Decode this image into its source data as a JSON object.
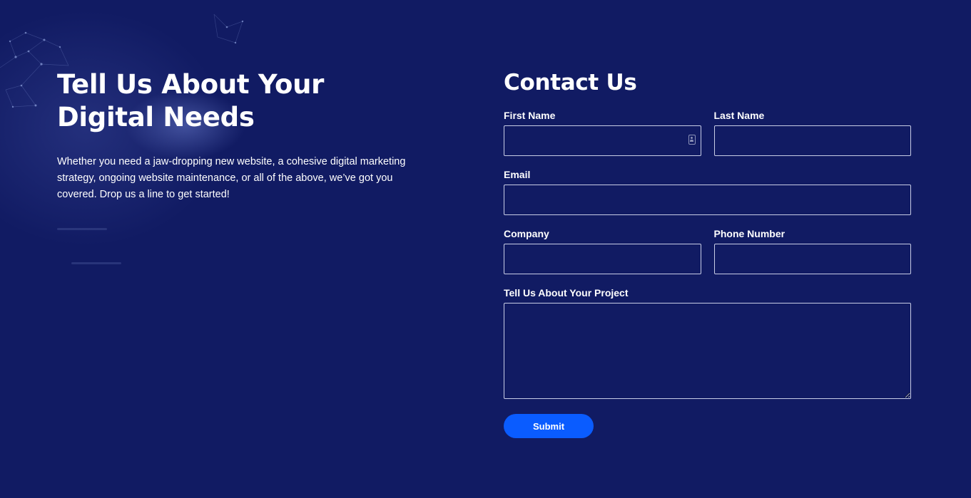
{
  "intro": {
    "title": "Tell Us About Your Digital Needs",
    "text": "Whether you need a jaw-dropping new website, a cohesive digital marketing strategy, ongoing website maintenance, or all of the above, we’ve got you covered. Drop us a line to get started!"
  },
  "contact_form": {
    "title": "Contact Us",
    "first_name": {
      "label": "First Name",
      "value": ""
    },
    "last_name": {
      "label": "Last Name",
      "value": ""
    },
    "email": {
      "label": "Email",
      "value": ""
    },
    "company": {
      "label": "Company",
      "value": ""
    },
    "phone": {
      "label": "Phone Number",
      "value": ""
    },
    "project": {
      "label": "Tell Us About Your Project",
      "value": ""
    },
    "submit_label": "Submit"
  },
  "colors": {
    "background": "#111b63",
    "accent_button": "#0a5cff",
    "text": "#ffffff",
    "input_border": "#c8cde6"
  },
  "icons": {
    "autofill": "contact-card-icon"
  }
}
